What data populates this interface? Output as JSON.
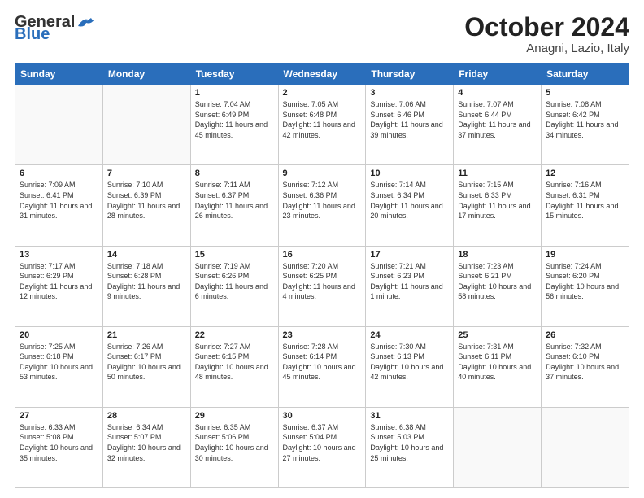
{
  "header": {
    "logo_general": "General",
    "logo_blue": "Blue",
    "month": "October 2024",
    "location": "Anagni, Lazio, Italy"
  },
  "weekdays": [
    "Sunday",
    "Monday",
    "Tuesday",
    "Wednesday",
    "Thursday",
    "Friday",
    "Saturday"
  ],
  "weeks": [
    [
      {
        "day": "",
        "info": ""
      },
      {
        "day": "",
        "info": ""
      },
      {
        "day": "1",
        "info": "Sunrise: 7:04 AM\nSunset: 6:49 PM\nDaylight: 11 hours and 45 minutes."
      },
      {
        "day": "2",
        "info": "Sunrise: 7:05 AM\nSunset: 6:48 PM\nDaylight: 11 hours and 42 minutes."
      },
      {
        "day": "3",
        "info": "Sunrise: 7:06 AM\nSunset: 6:46 PM\nDaylight: 11 hours and 39 minutes."
      },
      {
        "day": "4",
        "info": "Sunrise: 7:07 AM\nSunset: 6:44 PM\nDaylight: 11 hours and 37 minutes."
      },
      {
        "day": "5",
        "info": "Sunrise: 7:08 AM\nSunset: 6:42 PM\nDaylight: 11 hours and 34 minutes."
      }
    ],
    [
      {
        "day": "6",
        "info": "Sunrise: 7:09 AM\nSunset: 6:41 PM\nDaylight: 11 hours and 31 minutes."
      },
      {
        "day": "7",
        "info": "Sunrise: 7:10 AM\nSunset: 6:39 PM\nDaylight: 11 hours and 28 minutes."
      },
      {
        "day": "8",
        "info": "Sunrise: 7:11 AM\nSunset: 6:37 PM\nDaylight: 11 hours and 26 minutes."
      },
      {
        "day": "9",
        "info": "Sunrise: 7:12 AM\nSunset: 6:36 PM\nDaylight: 11 hours and 23 minutes."
      },
      {
        "day": "10",
        "info": "Sunrise: 7:14 AM\nSunset: 6:34 PM\nDaylight: 11 hours and 20 minutes."
      },
      {
        "day": "11",
        "info": "Sunrise: 7:15 AM\nSunset: 6:33 PM\nDaylight: 11 hours and 17 minutes."
      },
      {
        "day": "12",
        "info": "Sunrise: 7:16 AM\nSunset: 6:31 PM\nDaylight: 11 hours and 15 minutes."
      }
    ],
    [
      {
        "day": "13",
        "info": "Sunrise: 7:17 AM\nSunset: 6:29 PM\nDaylight: 11 hours and 12 minutes."
      },
      {
        "day": "14",
        "info": "Sunrise: 7:18 AM\nSunset: 6:28 PM\nDaylight: 11 hours and 9 minutes."
      },
      {
        "day": "15",
        "info": "Sunrise: 7:19 AM\nSunset: 6:26 PM\nDaylight: 11 hours and 6 minutes."
      },
      {
        "day": "16",
        "info": "Sunrise: 7:20 AM\nSunset: 6:25 PM\nDaylight: 11 hours and 4 minutes."
      },
      {
        "day": "17",
        "info": "Sunrise: 7:21 AM\nSunset: 6:23 PM\nDaylight: 11 hours and 1 minute."
      },
      {
        "day": "18",
        "info": "Sunrise: 7:23 AM\nSunset: 6:21 PM\nDaylight: 10 hours and 58 minutes."
      },
      {
        "day": "19",
        "info": "Sunrise: 7:24 AM\nSunset: 6:20 PM\nDaylight: 10 hours and 56 minutes."
      }
    ],
    [
      {
        "day": "20",
        "info": "Sunrise: 7:25 AM\nSunset: 6:18 PM\nDaylight: 10 hours and 53 minutes."
      },
      {
        "day": "21",
        "info": "Sunrise: 7:26 AM\nSunset: 6:17 PM\nDaylight: 10 hours and 50 minutes."
      },
      {
        "day": "22",
        "info": "Sunrise: 7:27 AM\nSunset: 6:15 PM\nDaylight: 10 hours and 48 minutes."
      },
      {
        "day": "23",
        "info": "Sunrise: 7:28 AM\nSunset: 6:14 PM\nDaylight: 10 hours and 45 minutes."
      },
      {
        "day": "24",
        "info": "Sunrise: 7:30 AM\nSunset: 6:13 PM\nDaylight: 10 hours and 42 minutes."
      },
      {
        "day": "25",
        "info": "Sunrise: 7:31 AM\nSunset: 6:11 PM\nDaylight: 10 hours and 40 minutes."
      },
      {
        "day": "26",
        "info": "Sunrise: 7:32 AM\nSunset: 6:10 PM\nDaylight: 10 hours and 37 minutes."
      }
    ],
    [
      {
        "day": "27",
        "info": "Sunrise: 6:33 AM\nSunset: 5:08 PM\nDaylight: 10 hours and 35 minutes."
      },
      {
        "day": "28",
        "info": "Sunrise: 6:34 AM\nSunset: 5:07 PM\nDaylight: 10 hours and 32 minutes."
      },
      {
        "day": "29",
        "info": "Sunrise: 6:35 AM\nSunset: 5:06 PM\nDaylight: 10 hours and 30 minutes."
      },
      {
        "day": "30",
        "info": "Sunrise: 6:37 AM\nSunset: 5:04 PM\nDaylight: 10 hours and 27 minutes."
      },
      {
        "day": "31",
        "info": "Sunrise: 6:38 AM\nSunset: 5:03 PM\nDaylight: 10 hours and 25 minutes."
      },
      {
        "day": "",
        "info": ""
      },
      {
        "day": "",
        "info": ""
      }
    ]
  ]
}
